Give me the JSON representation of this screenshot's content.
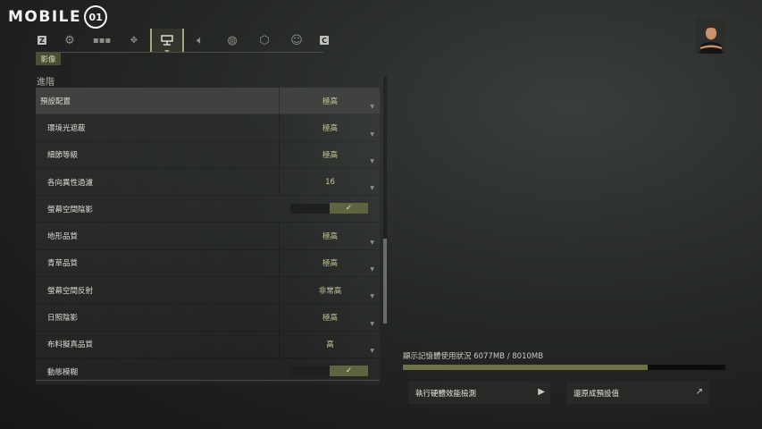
{
  "watermark": {
    "text": "MOBILE",
    "logo": "01"
  },
  "tabs": [
    {
      "icon": "key-z",
      "label": "Z"
    },
    {
      "icon": "gear-icon"
    },
    {
      "icon": "blocks-icon"
    },
    {
      "icon": "gamepad-icon"
    },
    {
      "icon": "display-icon",
      "active": true
    },
    {
      "icon": "speaker-icon"
    },
    {
      "icon": "globe-icon"
    },
    {
      "icon": "network-icon"
    },
    {
      "icon": "accessibility-icon"
    },
    {
      "icon": "key-c",
      "label": "C"
    }
  ],
  "subtab": "影像",
  "section_title": "進階",
  "preset": {
    "label": "預設配置",
    "value": "極高"
  },
  "settings": [
    {
      "label": "環境光遮蔽",
      "value": "極高"
    },
    {
      "label": "細節等級",
      "value": "極高"
    },
    {
      "label": "各向異性過濾",
      "value": "16"
    },
    {
      "label": "螢幕空間陰影",
      "value": "✓",
      "toggle": true
    },
    {
      "label": "地形品質",
      "value": "極高"
    },
    {
      "label": "青草品質",
      "value": "極高"
    },
    {
      "label": "螢幕空間反射",
      "value": "非常高"
    },
    {
      "label": "日照陰影",
      "value": "極高"
    },
    {
      "label": "布料擬真品質",
      "value": "高"
    },
    {
      "label": "動態模糊",
      "value": "✓",
      "toggle": true
    }
  ],
  "memory": {
    "label": "顯示記憶體使用狀況 6077MB / 8010MB",
    "used_mb": 6077,
    "total_mb": 8010
  },
  "buttons": {
    "benchmark": "執行硬體效能檢測",
    "reset": "還原成預設值"
  }
}
